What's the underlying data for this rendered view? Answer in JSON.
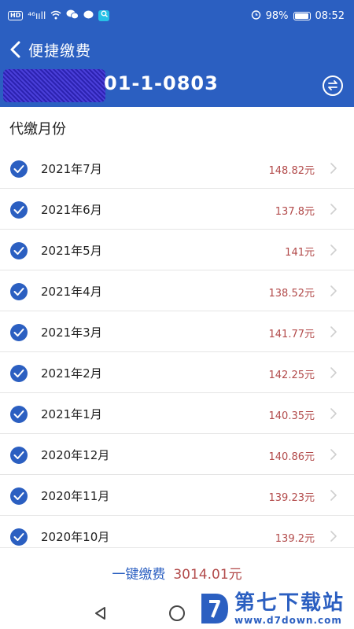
{
  "status_bar": {
    "network_badge": "HD",
    "signal": "⁴⁶ııll",
    "battery_percent": "98%",
    "time": "08:52"
  },
  "header": {
    "title": "便捷缴费",
    "account_suffix": "01-1-0803"
  },
  "section_title": "代缴月份",
  "months": [
    {
      "label": "2021年7月",
      "amount": "148.82元",
      "checked": true
    },
    {
      "label": "2021年6月",
      "amount": "137.8元",
      "checked": true
    },
    {
      "label": "2021年5月",
      "amount": "141元",
      "checked": true
    },
    {
      "label": "2021年4月",
      "amount": "138.52元",
      "checked": true
    },
    {
      "label": "2021年3月",
      "amount": "141.77元",
      "checked": true
    },
    {
      "label": "2021年2月",
      "amount": "142.25元",
      "checked": true
    },
    {
      "label": "2021年1月",
      "amount": "140.35元",
      "checked": true
    },
    {
      "label": "2020年12月",
      "amount": "140.86元",
      "checked": true
    },
    {
      "label": "2020年11月",
      "amount": "139.23元",
      "checked": true
    },
    {
      "label": "2020年10月",
      "amount": "139.2元",
      "checked": true
    }
  ],
  "bottom": {
    "pay_label": "一键缴费",
    "total": "3014.01元"
  },
  "watermark": {
    "name": "第七下载站",
    "url": "www.d7down.com"
  },
  "colors": {
    "primary": "#2b5fc1",
    "amount": "#b24a4a"
  }
}
